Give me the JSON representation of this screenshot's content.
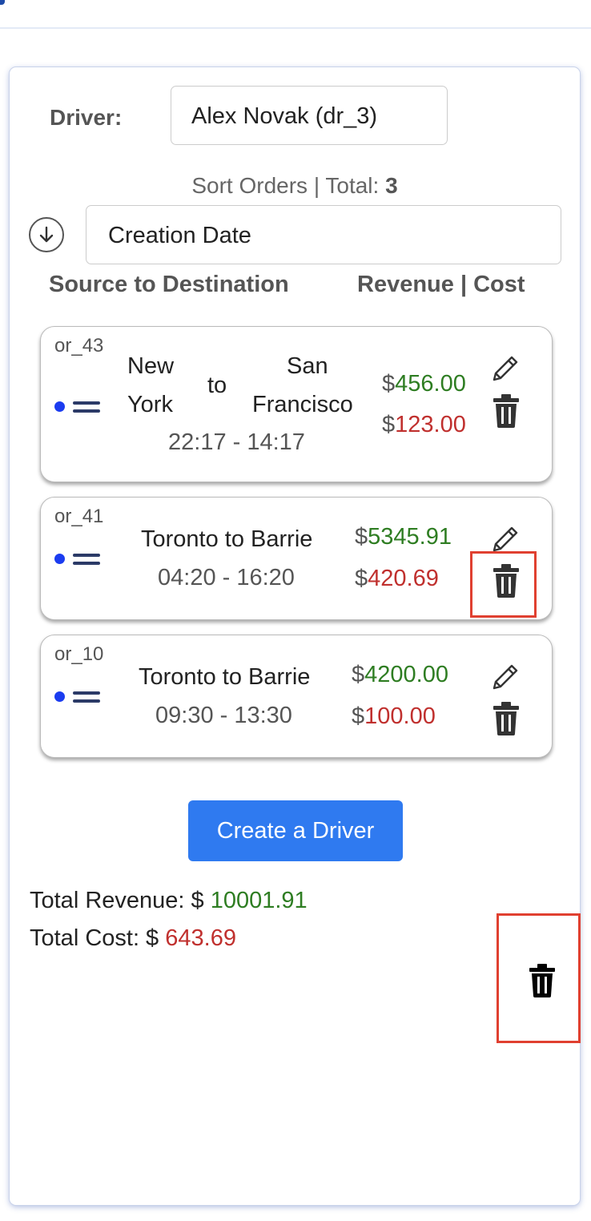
{
  "driver": {
    "label": "Driver:",
    "selected": "Alex Novak (dr_3)"
  },
  "sort": {
    "caption": "Sort Orders | Total: ",
    "total": "3",
    "selected": "Creation Date"
  },
  "columns": {
    "route": "Source to Destination",
    "money": "Revenue | Cost"
  },
  "currency": "$",
  "orders": [
    {
      "id": "or_43",
      "source": "New York",
      "source_l1": "New",
      "source_l2": "York",
      "to": "to",
      "dest_l1": "San",
      "dest_l2": "Francisco",
      "time": "22:17 - 14:17",
      "revenue": "456.00",
      "cost": "123.00"
    },
    {
      "id": "or_41",
      "route": "Toronto to Barrie",
      "time": "04:20 - 16:20",
      "revenue": "5345.91",
      "cost": "420.69"
    },
    {
      "id": "or_10",
      "route": "Toronto to Barrie",
      "time": "09:30 - 13:30",
      "revenue": "4200.00",
      "cost": "100.00"
    }
  ],
  "actions": {
    "create_driver": "Create a Driver"
  },
  "totals": {
    "revenue_label": "Total Revenue: $ ",
    "revenue": "10001.91",
    "cost_label": "Total Cost: $ ",
    "cost": "643.69"
  },
  "colors": {
    "accent": "#2f7af0",
    "revenue": "#2e7d22",
    "cost": "#c0302e",
    "highlight": "#e04030"
  },
  "icons": {
    "edit": "pencil-icon",
    "delete": "trash-icon",
    "sort": "arrow-down-circle-icon",
    "drag": "drag-handle-icon"
  }
}
